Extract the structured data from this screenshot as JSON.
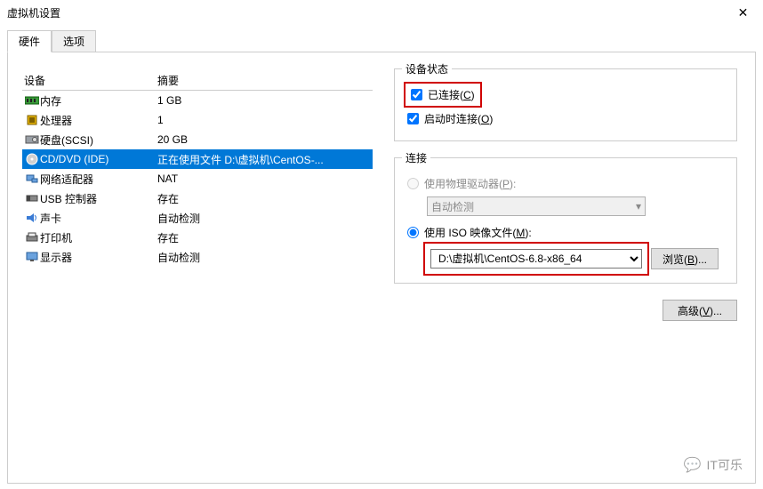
{
  "window": {
    "title": "虚拟机设置"
  },
  "tabs": {
    "hardware": "硬件",
    "options": "选项"
  },
  "deviceTable": {
    "colDevice": "设备",
    "colSummary": "摘要",
    "rows": {
      "memory": {
        "name": "内存",
        "summary": "1 GB"
      },
      "cpu": {
        "name": "处理器",
        "summary": "1"
      },
      "hdd": {
        "name": "硬盘(SCSI)",
        "summary": "20 GB"
      },
      "cd": {
        "name": "CD/DVD (IDE)",
        "summary": "正在使用文件 D:\\虚拟机\\CentOS-..."
      },
      "net": {
        "name": "网络适配器",
        "summary": "NAT"
      },
      "usb": {
        "name": "USB 控制器",
        "summary": "存在"
      },
      "sound": {
        "name": "声卡",
        "summary": "自动检测"
      },
      "printer": {
        "name": "打印机",
        "summary": "存在"
      },
      "display": {
        "name": "显示器",
        "summary": "自动检测"
      }
    }
  },
  "deviceStatus": {
    "groupTitle": "设备状态",
    "connected_pre": "已连接(",
    "connected_key": "C",
    "connected_post": ")",
    "connectAtPowerOn_pre": "启动时连接(",
    "connectAtPowerOn_key": "O",
    "connectAtPowerOn_post": ")"
  },
  "connection": {
    "groupTitle": "连接",
    "physical_pre": "使用物理驱动器(",
    "physical_key": "P",
    "physical_post": "):",
    "physicalDrive": "自动检测",
    "iso_pre": "使用 ISO 映像文件(",
    "iso_key": "M",
    "iso_post": "):",
    "isoPath": "D:\\虚拟机\\CentOS-6.8-x86_64",
    "browse_pre": "浏览(",
    "browse_key": "B",
    "browse_post": ")..."
  },
  "advanced": {
    "label_pre": "高级(",
    "label_key": "V",
    "label_post": ")..."
  },
  "watermark": "IT可乐"
}
